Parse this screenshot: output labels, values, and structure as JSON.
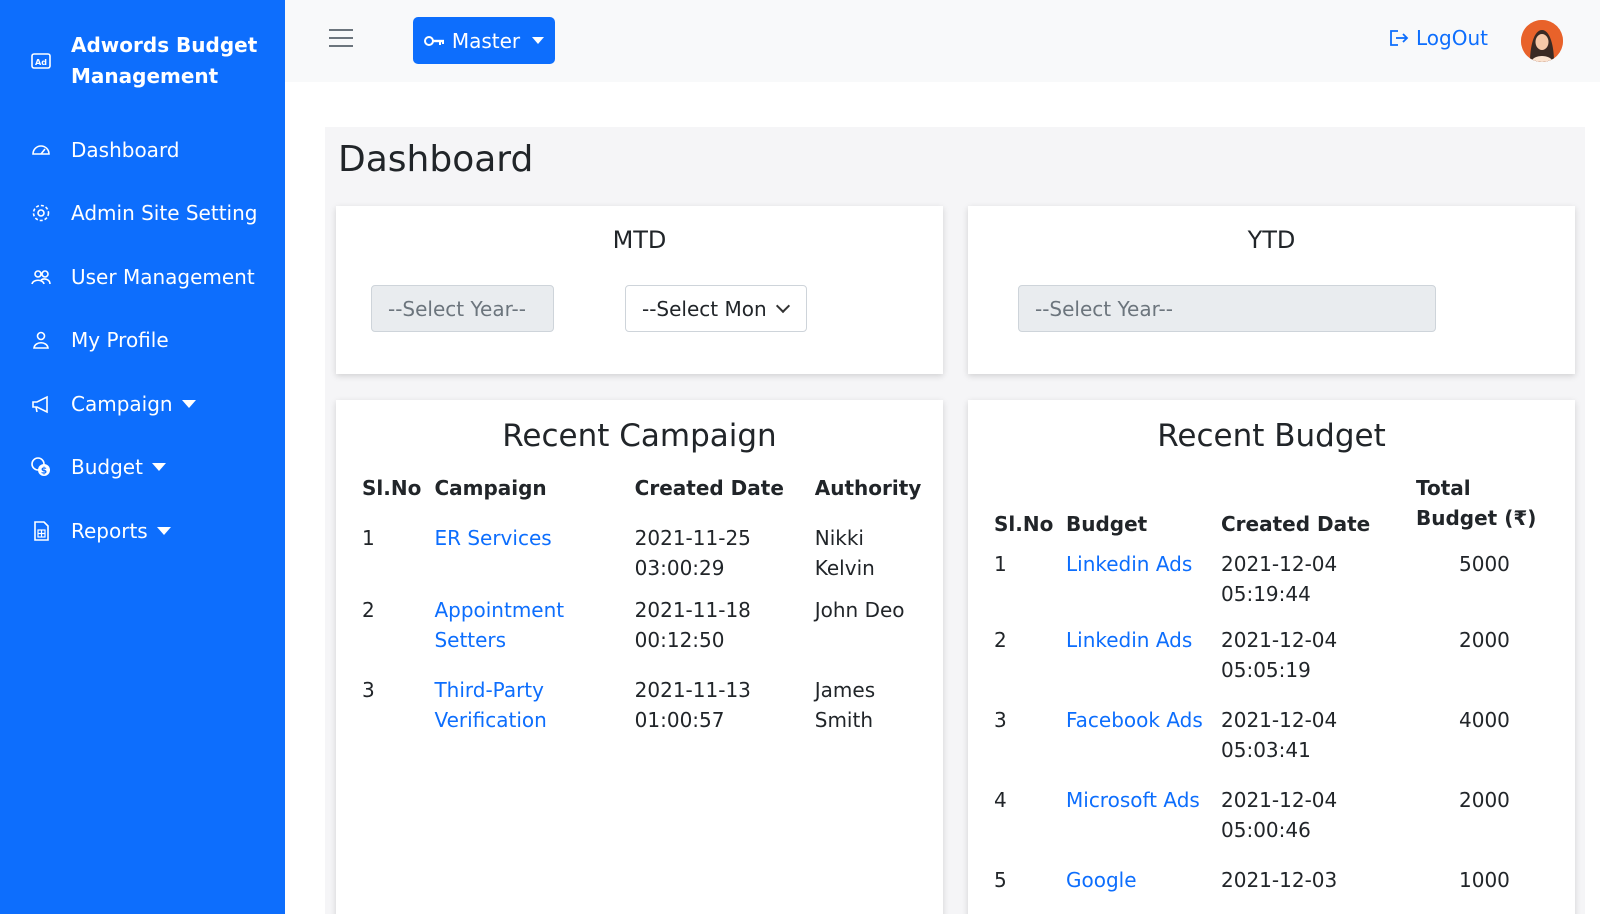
{
  "sidebar": {
    "brand": "Adwords Budget Management",
    "items": [
      {
        "label": "Dashboard",
        "icon": "dashboard-icon"
      },
      {
        "label": "Admin Site Setting",
        "icon": "gear-icon"
      },
      {
        "label": "User Management",
        "icon": "users-icon"
      },
      {
        "label": "My Profile",
        "icon": "user-icon"
      },
      {
        "label": "Campaign",
        "icon": "megaphone-icon",
        "dropdown": true
      },
      {
        "label": "Budget",
        "icon": "coins-icon",
        "dropdown": true
      },
      {
        "label": "Reports",
        "icon": "document-icon",
        "dropdown": true
      }
    ]
  },
  "topbar": {
    "master_label": "Master",
    "logout_label": "LogOut"
  },
  "page": {
    "title": "Dashboard"
  },
  "mtd": {
    "title": "MTD",
    "year_placeholder": "--Select Year--",
    "month_placeholder": "--Select Mon"
  },
  "ytd": {
    "title": "YTD",
    "year_placeholder": "--Select Year--"
  },
  "recent_campaign": {
    "title": "Recent Campaign",
    "headers": [
      "Sl.No",
      "Campaign",
      "Created Date",
      "Authority"
    ],
    "rows": [
      {
        "no": "1",
        "name": "ER Services",
        "date": "2021-11-25",
        "time": "03:00:29",
        "authority": "Nikki Kelvin"
      },
      {
        "no": "2",
        "name": "Appointment Setters",
        "date": "2021-11-18",
        "time": "00:12:50",
        "authority": "John Deo"
      },
      {
        "no": "3",
        "name": "Third-Party Verification",
        "date": "2021-11-13",
        "time": "01:00:57",
        "authority": "James Smith"
      }
    ]
  },
  "recent_budget": {
    "title": "Recent Budget",
    "headers": [
      "Sl.No",
      "Budget",
      "Created Date",
      "Total Budget (₹)"
    ],
    "rows": [
      {
        "no": "1",
        "name": "Linkedin Ads",
        "date": "2021-12-04",
        "time": "05:19:44",
        "total": "5000"
      },
      {
        "no": "2",
        "name": "Linkedin Ads",
        "date": "2021-12-04",
        "time": "05:05:19",
        "total": "2000"
      },
      {
        "no": "3",
        "name": "Facebook Ads",
        "date": "2021-12-04",
        "time": "05:03:41",
        "total": "4000"
      },
      {
        "no": "4",
        "name": "Microsoft Ads",
        "date": "2021-12-04",
        "time": "05:00:46",
        "total": "2000"
      },
      {
        "no": "5",
        "name": "Google",
        "date": "2021-12-03",
        "time": "",
        "total": "1000"
      }
    ]
  },
  "colors": {
    "primary": "#0d6efd",
    "sidebar_bg": "#0d6efd",
    "topbar_bg": "#f8f9fa"
  }
}
